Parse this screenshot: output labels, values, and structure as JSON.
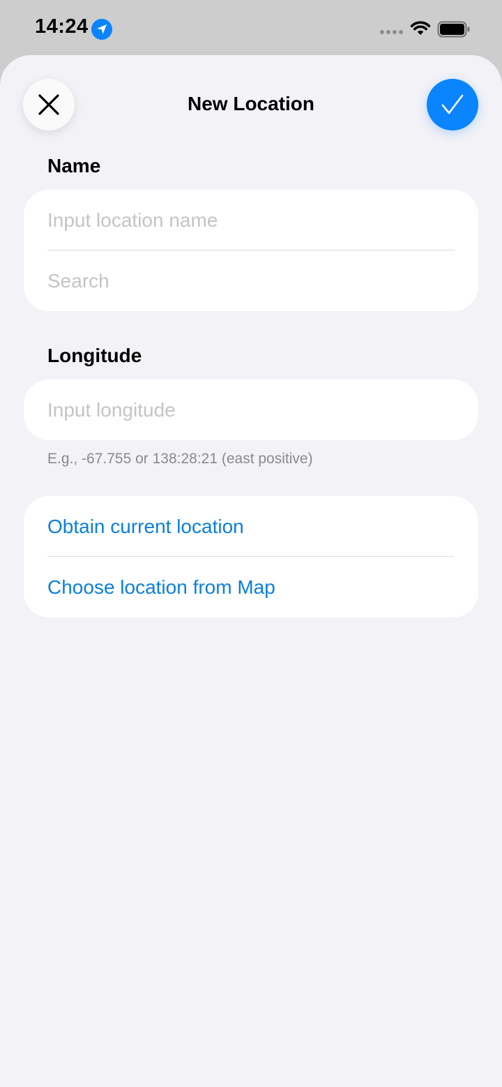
{
  "status_bar": {
    "time": "14:24",
    "location_icon": "location-arrow-icon",
    "signal_icon": "cellular-dots-icon",
    "wifi_icon": "wifi-icon",
    "battery_icon": "battery-icon"
  },
  "header": {
    "title": "New Location",
    "close_icon": "close-icon",
    "done_icon": "checkmark-icon"
  },
  "name_section": {
    "label": "Name",
    "name_placeholder": "Input location name",
    "search_placeholder": "Search"
  },
  "longitude_section": {
    "label": "Longitude",
    "placeholder": "Input longitude",
    "hint": "E.g., -67.755 or 138:28:21 (east positive)"
  },
  "actions": {
    "obtain_current": "Obtain current location",
    "choose_from_map": "Choose location from Map"
  },
  "colors": {
    "accent": "#0a84ff",
    "link": "#0a7fdc",
    "background": "#f2f2f7"
  }
}
